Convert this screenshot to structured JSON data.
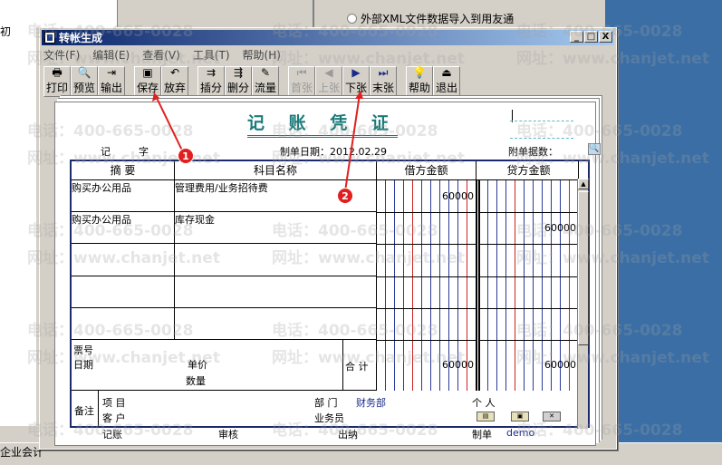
{
  "background": {
    "left_label": "初",
    "left_bottom_label": "企业会计",
    "radio_option": "外部XML文件数据导入到用友通"
  },
  "window": {
    "title": "转帐生成",
    "buttons": {
      "minimize": "_",
      "maximize": "□",
      "close": "X"
    }
  },
  "menu": [
    {
      "label": "文件(F)"
    },
    {
      "label": "编辑(E)"
    },
    {
      "label": "查看(V)"
    },
    {
      "label": "工具(T)"
    },
    {
      "label": "帮助(H)"
    }
  ],
  "toolbar": {
    "print": "打印",
    "preview": "预览",
    "output": "输出",
    "save": "保存",
    "abandon": "放弃",
    "insert": "插分",
    "delete": "删分",
    "flow": "流量",
    "first": "首张",
    "prev": "上张",
    "next": "下张",
    "last": "末张",
    "help": "帮助",
    "exit": "退出"
  },
  "voucher": {
    "title": "记 账 凭 证",
    "zi_label": "记",
    "zi_suffix": "字",
    "date_label": "制单日期：2012.02.29",
    "attachments_label": "附单据数：",
    "columns": {
      "summary": "摘 要",
      "account": "科目名称",
      "debit": "借方金额",
      "credit": "贷方金额"
    },
    "rows": [
      {
        "summary": "购买办公用品",
        "account": "管理费用/业务招待费",
        "debit": "60000",
        "credit": ""
      },
      {
        "summary": "购买办公用品",
        "account": "库存现金",
        "debit": "",
        "credit": "60000"
      },
      {
        "summary": "",
        "account": "",
        "debit": "",
        "credit": ""
      },
      {
        "summary": "",
        "account": "",
        "debit": "",
        "credit": ""
      },
      {
        "summary": "",
        "account": "",
        "debit": "",
        "credit": ""
      }
    ],
    "ticket_no": "票号",
    "ticket_date": "日期",
    "unit_price": "单价",
    "quantity": "数量",
    "total_label": "合 计",
    "total_debit": "60000",
    "total_credit": "60000",
    "remarks_label": "备注",
    "project_label": "项 目",
    "customer_label": "客 户",
    "dept_label": "部 门",
    "dept_value": "财务部",
    "person_label": "个 人",
    "salesman_label": "业务员",
    "footer": {
      "bookkeeping": "记账",
      "review": "审核",
      "cashier": "出纳",
      "maker_label": "制单",
      "maker_value": "demo"
    }
  },
  "watermark": {
    "phone": "电话：400-665-0028",
    "site": "网址：www.chanjet.net"
  },
  "annotations": {
    "badge1": "1",
    "badge2": "2"
  },
  "colors": {
    "title_teal": "#1a7a7a",
    "grid_blue": "#1a2a6a",
    "badge_red": "#e02020",
    "desktop_blue": "#3a6ea5"
  }
}
